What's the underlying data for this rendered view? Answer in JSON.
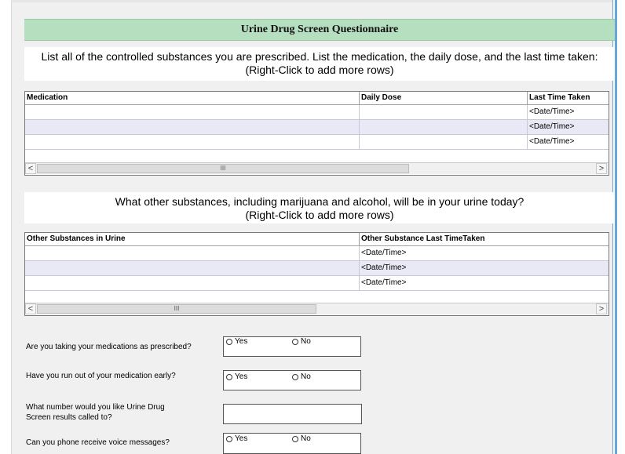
{
  "form": {
    "title": "Urine Drug Screen Questionnaire",
    "section1": {
      "line1": "List all of the controlled substances you are prescribed.  List the medication, the daily dose, and the last time taken:",
      "line2": "(Right-Click to add more rows)"
    },
    "grid1": {
      "headers": [
        "Medication",
        "Daily Dose",
        "Last Time Taken"
      ],
      "placeholder": "<Date/Time>"
    },
    "section2": {
      "line1": "What other substances, including marijuana and alcohol, will be in your urine today?",
      "line2": "(Right-Click to add more rows)"
    },
    "grid2": {
      "headers": [
        "Other Substances in Urine",
        "Other Substance Last TimeTaken"
      ],
      "placeholder": "<Date/Time>"
    },
    "scroll": {
      "left": "<",
      "right": ">",
      "grip": "III"
    },
    "questions": {
      "q1": "Are you taking your medications as prescribed?",
      "q2": "Have you run out of your medication early?",
      "q3_line1": "What number would you like Urine Drug",
      "q3_line2": "Screen results called to?",
      "q4": "Can you phone receive voice messages?"
    },
    "options": {
      "yes": "Yes",
      "no": "No"
    }
  }
}
